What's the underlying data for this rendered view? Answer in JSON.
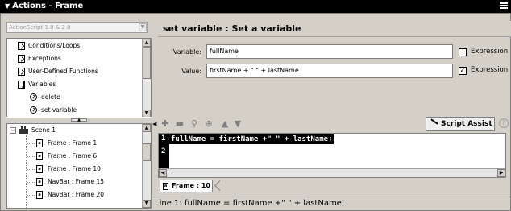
{
  "panel": {
    "title": "Actions - Frame",
    "collapse_icon": "triangle-down-icon",
    "menu_icon": "panel-menu-icon"
  },
  "toolbox": {
    "version": "ActionScript 1.0 & 2.0",
    "items": [
      {
        "label": "Conditions/Loops",
        "icon": "book-icon"
      },
      {
        "label": "Exceptions",
        "icon": "book-icon"
      },
      {
        "label": "User-Defined Functions",
        "icon": "book-icon"
      },
      {
        "label": "Variables",
        "icon": "book-open-icon"
      },
      {
        "label": "delete",
        "icon": "action-circle-icon"
      },
      {
        "label": "set variable",
        "icon": "action-circle-icon"
      }
    ]
  },
  "scene_tree": {
    "scene": "Scene 1",
    "frames": [
      "Frame : Frame 1",
      "Frame : Frame 6",
      "Frame : Frame 10",
      "NavBar : Frame 15",
      "NavBar : Frame 20"
    ]
  },
  "action": {
    "heading": "set variable : Set a variable",
    "variable_label": "Variable:",
    "variable_value": "fullName",
    "value_label": "Value:",
    "value_value": "firstName + \" \" + lastName",
    "expression_label": "Expression",
    "variable_expression_checked": false,
    "value_expression_checked": true
  },
  "toolbar": {
    "script_assist_label": "Script Assist"
  },
  "editor": {
    "lines": [
      {
        "num": "1",
        "code": "fullName = firstName +\" \" + lastName;"
      },
      {
        "num": "2",
        "code": ""
      }
    ]
  },
  "tab": {
    "label": "Frame : 10"
  },
  "status": {
    "text": "Line 1: fullName = firstName +\" \" + lastName;"
  }
}
